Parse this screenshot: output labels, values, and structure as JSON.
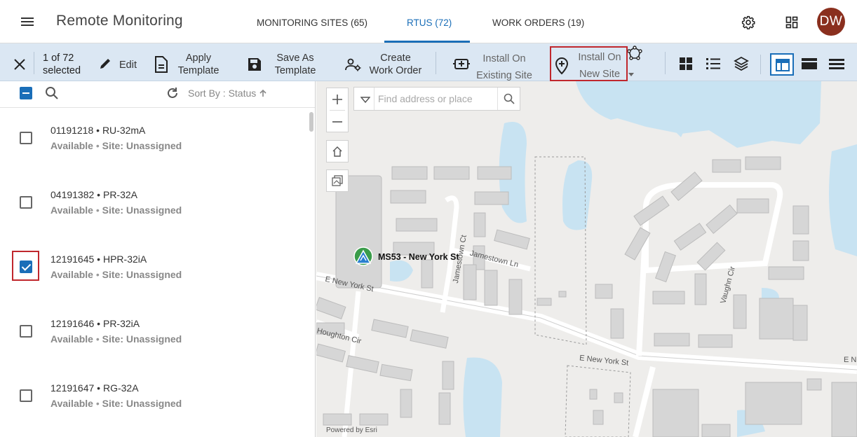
{
  "header": {
    "title": "Remote Monitoring",
    "tabs": [
      {
        "label": "MONITORING SITES (65)",
        "active": false
      },
      {
        "label": "RTUS (72)",
        "active": true
      },
      {
        "label": "WORK ORDERS (19)",
        "active": false
      }
    ],
    "avatar_initials": "DW",
    "colors": {
      "accent": "#1a6eb8",
      "avatar": "#8a2f1e",
      "highlight": "#c0272d"
    }
  },
  "toolbar": {
    "selection_line1": "1 of 72",
    "selection_line2": "selected",
    "edit": "Edit",
    "apply_template_1": "Apply",
    "apply_template_2": "Template",
    "save_template_1": "Save As",
    "save_template_2": "Template",
    "create_wo_1": "Create",
    "create_wo_2": "Work Order",
    "install_existing_1": "Install On",
    "install_existing_2": "Existing Site",
    "install_new_1": "Install On",
    "install_new_2": "New Site"
  },
  "list": {
    "sort_label": "Sort By : Status",
    "items": [
      {
        "id": "01191218",
        "model": "RU-32mA",
        "status": "Available",
        "site": "Site: Unassigned",
        "checked": false
      },
      {
        "id": "04191382",
        "model": "PR-32A",
        "status": "Available",
        "site": "Site: Unassigned",
        "checked": false
      },
      {
        "id": "12191645",
        "model": "HPR-32iA",
        "status": "Available",
        "site": "Site: Unassigned",
        "checked": true
      },
      {
        "id": "12191646",
        "model": "PR-32iA",
        "status": "Available",
        "site": "Site: Unassigned",
        "checked": false
      },
      {
        "id": "12191647",
        "model": "RG-32A",
        "status": "Available",
        "site": "Site: Unassigned",
        "checked": false
      }
    ]
  },
  "map": {
    "search_placeholder": "Find address or place",
    "site_label": "MS53 - New York St",
    "attribution": "Powered by Esri",
    "streets": {
      "new_york_west": "E New York St",
      "new_york_east": "E New York St",
      "new_york_far": "E N",
      "jamestown_ct": "Jamestown Ct",
      "jamestown_ln": "Jamestown Ln",
      "houghton": "Houghton Cir",
      "vaughn": "Vaughn Cir"
    }
  }
}
